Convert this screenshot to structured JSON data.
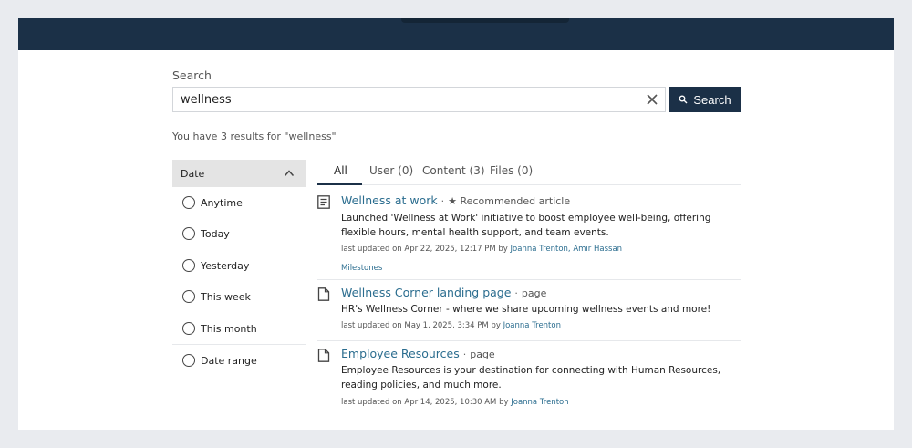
{
  "search": {
    "label": "Search",
    "query": "wellness",
    "button_label": "Search",
    "summary": "You have 3 results for \"wellness\""
  },
  "filter": {
    "title": "Date",
    "options": [
      "Anytime",
      "Today",
      "Yesterday",
      "This week",
      "This month",
      "Date range"
    ]
  },
  "tabs": [
    {
      "label": "All",
      "active": true
    },
    {
      "label": "User (0)",
      "active": false
    },
    {
      "label": "Content (3)",
      "active": false
    },
    {
      "label": "Files (0)",
      "active": false
    }
  ],
  "results": [
    {
      "icon": "article-icon",
      "title": "Wellness at work",
      "separator": "·",
      "type": "★ Recommended article",
      "description": "Launched 'Wellness at Work' initiative to boost employee well-being, offering flexible hours, mental health support, and team events.",
      "meta_prefix": "last updated on",
      "date": "Apr 22, 2025, 12:17 PM",
      "by": "by",
      "authors": "Joanna Trenton, Amir Hassan",
      "tag": "Milestones"
    },
    {
      "icon": "page-icon",
      "title": "Wellness Corner landing page",
      "separator": "·",
      "type": "page",
      "description": "HR's Wellness Corner - where we share upcoming wellness events and more!",
      "meta_prefix": "last updated on",
      "date": "May 1, 2025, 3:34 PM",
      "by": "by",
      "authors": "Joanna Trenton"
    },
    {
      "icon": "page-icon",
      "title": "Employee Resources",
      "separator": "·",
      "type": "page",
      "description": "Employee Resources is your destination for connecting with Human Resources, reading policies, and much more.",
      "meta_prefix": "last updated on",
      "date": "Apr 14, 2025, 10:30 AM",
      "by": "by",
      "authors": "Joanna Trenton"
    }
  ],
  "colors": {
    "header": "#1b3047",
    "link": "#2b6d8f",
    "filter_header_bg": "#e4e4e4"
  }
}
